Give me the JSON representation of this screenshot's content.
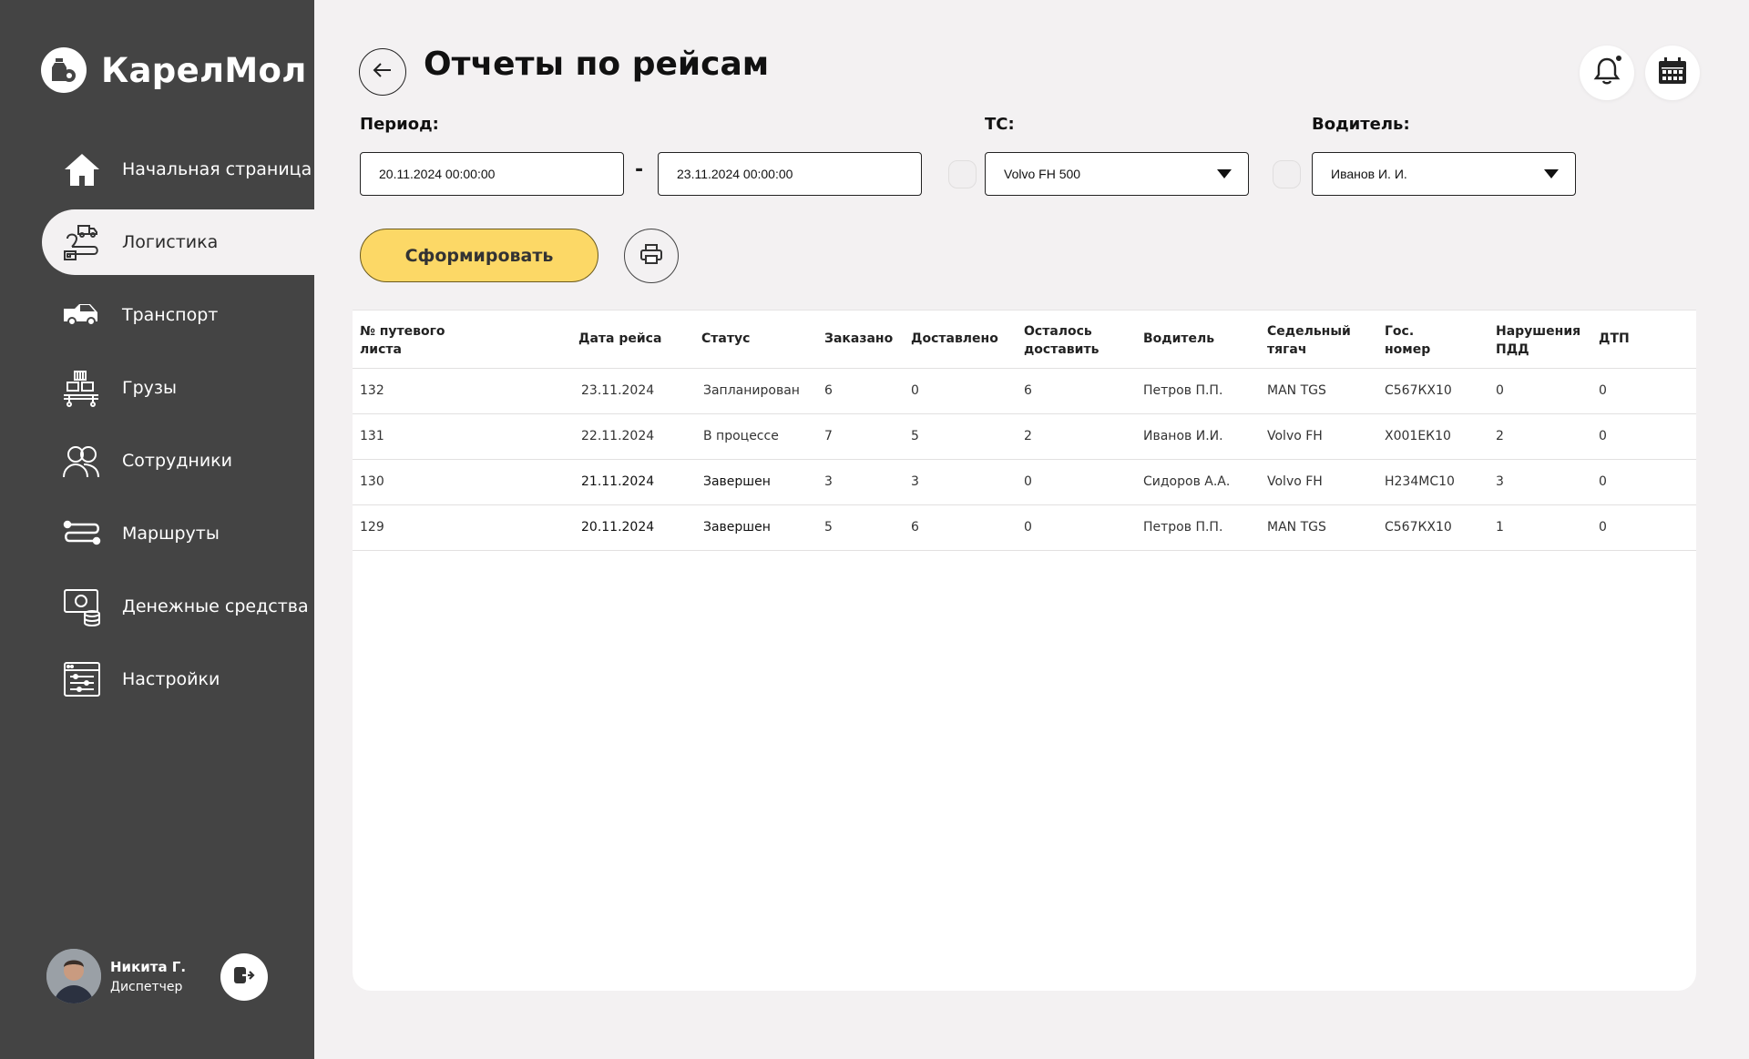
{
  "app": {
    "brand": "КарелМол"
  },
  "sidebar": {
    "items": [
      {
        "label": "Начальная страница",
        "icon": "home-icon"
      },
      {
        "label": "Логистика",
        "icon": "logistics-icon",
        "active": true
      },
      {
        "label": "Транспорт",
        "icon": "truck-icon"
      },
      {
        "label": "Грузы",
        "icon": "cargo-icon"
      },
      {
        "label": "Сотрудники",
        "icon": "employees-icon"
      },
      {
        "label": "Маршруты",
        "icon": "routes-icon"
      },
      {
        "label": "Денежные средства",
        "icon": "money-icon"
      },
      {
        "label": "Настройки",
        "icon": "settings-icon"
      }
    ]
  },
  "user": {
    "name": "Никита Г.",
    "role": "Диспетчер"
  },
  "header": {
    "title": "Отчеты по рейсам"
  },
  "filters": {
    "period_label": "Период:",
    "period_from": "20.11.2024 00:00:00",
    "period_separator": "-",
    "period_to": "23.11.2024 00:00:00",
    "vehicle_label": "ТС:",
    "vehicle_value": "Volvo FH 500",
    "driver_label": "Водитель:",
    "driver_value": "Иванов И. И."
  },
  "actions": {
    "generate_label": "Сформировать"
  },
  "table": {
    "headers": [
      "№ путевого\nлиста",
      "Дата рейса",
      "Статус",
      "Заказано",
      "Доставлено",
      "Осталось\nдоставить",
      "Водитель",
      "Седельный\nтягач",
      "Гос.\nномер",
      "Нарушения\nПДД",
      "ДТП"
    ],
    "rows": [
      [
        "132",
        "23.11.2024",
        "Запланирован",
        "6",
        "0",
        "6",
        "Петров П.П.",
        "MAN TGS",
        "С567КХ10",
        "0",
        "0"
      ],
      [
        "131",
        "22.11.2024",
        "В процессе",
        "7",
        "5",
        "2",
        "Иванов И.И.",
        "Volvo FH",
        "Х001ЕК10",
        "2",
        "0"
      ],
      [
        "130",
        "21.11.2024",
        "Завершен",
        "3",
        "3",
        "0",
        "Сидоров А.А.",
        "Volvo FH",
        "Н234МС10",
        "3",
        "0"
      ],
      [
        "129",
        "20.11.2024",
        "Завершен",
        "5",
        "6",
        "0",
        "Петров П.П.",
        "MAN TGS",
        "С567КХ10",
        "1",
        "0"
      ]
    ]
  },
  "colors": {
    "sidebar": "#444444",
    "background": "#f3f1f2",
    "accent": "#fcd866"
  }
}
